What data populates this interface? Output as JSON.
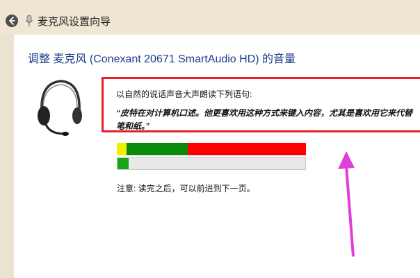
{
  "window": {
    "title": "麦克风设置向导"
  },
  "heading": "调整 麦克风 (Conexant 20671 SmartAudio HD) 的音量",
  "instruction": "以自然的说话声音大声朗读下列语句:",
  "quote": "“皮特在对计算机口述。他更喜欢用这种方式来键入内容，尤其是喜欢用它来代替笔和纸。”",
  "note": "注意: 读完之后，可以前进到下一页。",
  "meters": {
    "volume_colors": {
      "low": "#f2ef00",
      "mid": "#0a8a0a",
      "high": "#ff0000"
    },
    "level_fraction": 0.06,
    "level_color": "#1aa41a"
  },
  "colors": {
    "highlight_box": "#e81e2b",
    "arrow": "#e040d8",
    "heading": "#1b3d8c"
  },
  "icons": {
    "back": "back-arrow-icon",
    "mic": "microphone-icon",
    "headset": "headset-icon"
  }
}
